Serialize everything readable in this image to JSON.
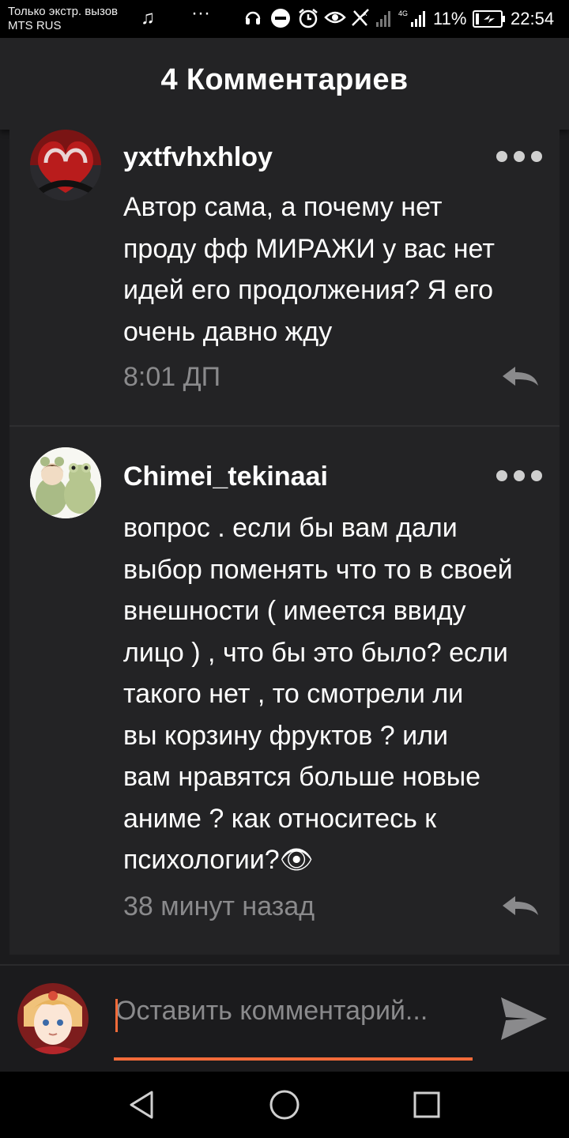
{
  "status_bar": {
    "carrier_line1": "Только экстр. вызов",
    "carrier_line2": "MTS RUS",
    "network": "4G",
    "battery": "11%",
    "time": "22:54"
  },
  "header": {
    "title": "4 Комментариев"
  },
  "comments": [
    {
      "username": "yxtfvhxhloy",
      "lines": [
        "Автор сама, а почему нет",
        "проду фф МИРАЖИ у вас нет",
        "идей его продолжения? Я его",
        "очень давно жду"
      ],
      "time": "8:01 ДП"
    },
    {
      "username": "Chimei_tekinaai",
      "lines": [
        "вопрос . если бы вам дали",
        "выбор поменять что то в своей",
        "внешности ( имеется ввиду",
        "лицо ) , что бы это было? если",
        "такого нет , то смотрели ли",
        "вы корзину фруктов ? или",
        "вам нравятся больше новые",
        "аниме ? как относитесь к",
        "психологии?👁"
      ],
      "time": "38 минут назад"
    }
  ],
  "composer": {
    "placeholder": "Оставить комментарий..."
  },
  "colors": {
    "accent": "#f26b3a",
    "card": "#232325",
    "background": "#1b1b1d",
    "muted": "#8a8a8c"
  }
}
